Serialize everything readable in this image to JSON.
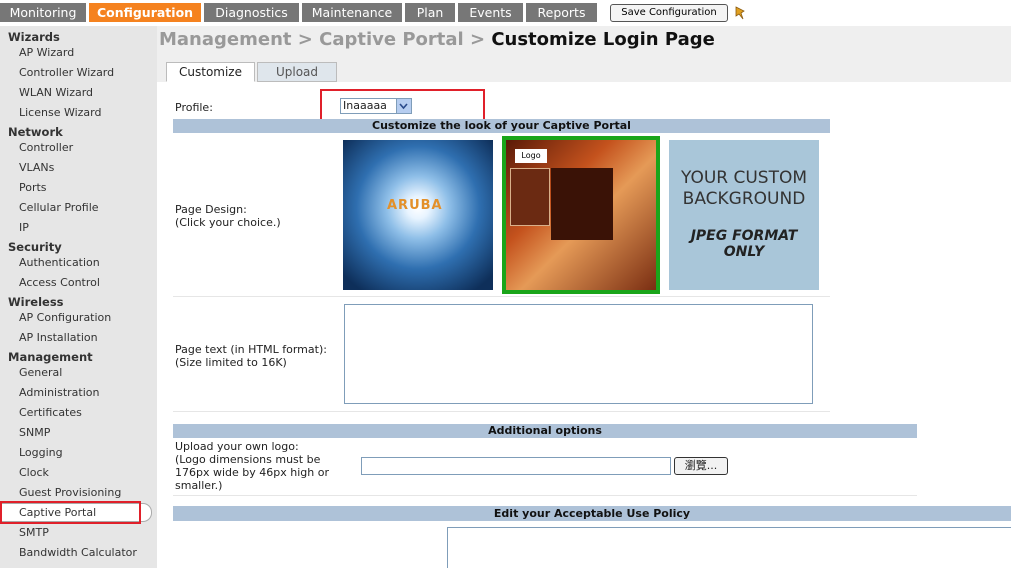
{
  "topnav": {
    "tabs": [
      {
        "label": "Monitoring"
      },
      {
        "label": "Configuration"
      },
      {
        "label": "Diagnostics"
      },
      {
        "label": "Maintenance"
      },
      {
        "label": "Plan"
      },
      {
        "label": "Events"
      },
      {
        "label": "Reports"
      }
    ],
    "active_tab": "Configuration",
    "save_label": "Save Configuration"
  },
  "sidebar": {
    "groups": [
      {
        "heading": "Wizards",
        "items": [
          "AP Wizard",
          "Controller Wizard",
          "WLAN Wizard",
          "License Wizard"
        ]
      },
      {
        "heading": "Network",
        "items": [
          "Controller",
          "VLANs",
          "Ports",
          "Cellular Profile",
          "IP"
        ]
      },
      {
        "heading": "Security",
        "items": [
          "Authentication",
          "Access Control"
        ]
      },
      {
        "heading": "Wireless",
        "items": [
          "AP Configuration",
          "AP Installation"
        ]
      },
      {
        "heading": "Management",
        "items": [
          "General",
          "Administration",
          "Certificates",
          "SNMP",
          "Logging",
          "Clock",
          "Guest Provisioning",
          "Captive Portal",
          "SMTP",
          "Bandwidth Calculator"
        ]
      }
    ],
    "selected": "Captive Portal"
  },
  "breadcrumb": {
    "part1": "Management > Captive Portal > ",
    "current": "Customize Login Page"
  },
  "content_tabs": [
    {
      "label": "Customize"
    },
    {
      "label": "Upload"
    }
  ],
  "form": {
    "profile_label": "Profile:",
    "profile_value": "Inaaaaa",
    "section1_title": "Customize the look of your Captive Portal",
    "page_design_label": "Page Design:",
    "page_design_hint": "(Click your choice.)",
    "design1_logo": "ARUBA",
    "design2_logo": "Logo",
    "design3_line1": "YOUR CUSTOM",
    "design3_line2": "BACKGROUND",
    "design3_line3": "JPEG FORMAT ONLY",
    "page_text_label": "Page text (in HTML format):",
    "page_text_hint": "(Size limited to 16K)",
    "section2_title": "Additional options",
    "logo_label": "Upload your own logo:",
    "logo_hint1": "(Logo dimensions must be",
    "logo_hint2": "176px wide by 46px high or",
    "logo_hint3": "smaller.)",
    "browse_label": "瀏覽...",
    "section3_title": "Edit your Acceptable Use Policy"
  },
  "colors": {
    "accent": "#f5821f",
    "nav_tab": "#777777",
    "section_bar": "#aec2d8",
    "highlight": "#e0202a",
    "selected_border": "#1aa51a"
  }
}
